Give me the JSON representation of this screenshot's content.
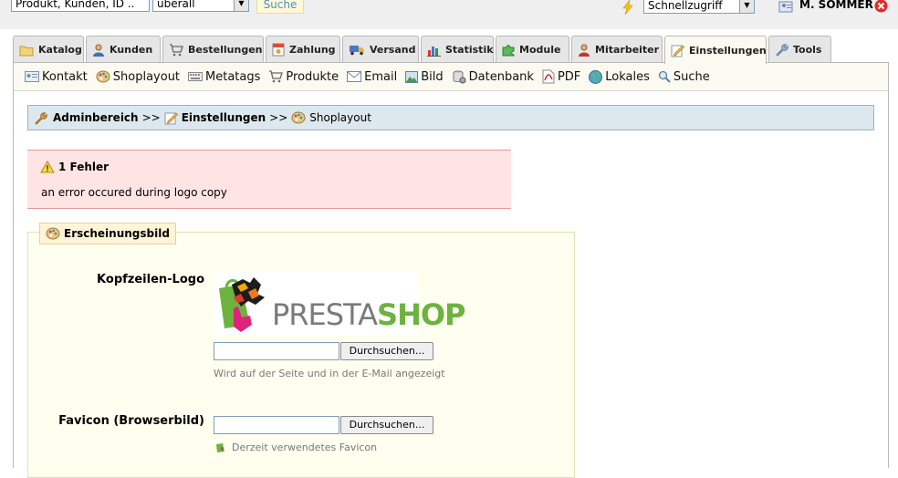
{
  "topbar": {
    "search_value": "Produkt, Kunden, ID ..",
    "scope_value": "überall",
    "search_button": "Suche",
    "quick_access": "Schnellzugriff",
    "user_name": "M. SOMMER"
  },
  "tabs": [
    {
      "label": "Katalog",
      "icon": "folder-icon"
    },
    {
      "label": "Kunden",
      "icon": "user-icon"
    },
    {
      "label": "Bestellungen",
      "icon": "cart-icon"
    },
    {
      "label": "Zahlung",
      "icon": "payment-icon"
    },
    {
      "label": "Versand",
      "icon": "truck-icon"
    },
    {
      "label": "Statistik",
      "icon": "chart-icon"
    },
    {
      "label": "Module",
      "icon": "puzzle-icon"
    },
    {
      "label": "Mitarbeiter",
      "icon": "staff-icon"
    },
    {
      "label": "Einstellungen",
      "icon": "settings-icon",
      "active": true
    },
    {
      "label": "Tools",
      "icon": "wrench-icon"
    }
  ],
  "subnav": [
    {
      "label": "Kontakt",
      "icon": "contact-card-icon"
    },
    {
      "label": "Shoplayout",
      "icon": "palette-icon"
    },
    {
      "label": "Metatags",
      "icon": "keyboard-icon"
    },
    {
      "label": "Produkte",
      "icon": "cart-icon"
    },
    {
      "label": "Email",
      "icon": "email-icon"
    },
    {
      "label": "Bild",
      "icon": "image-icon"
    },
    {
      "label": "Datenbank",
      "icon": "database-icon"
    },
    {
      "label": "PDF",
      "icon": "pdf-icon"
    },
    {
      "label": "Lokales",
      "icon": "globe-icon"
    },
    {
      "label": "Suche",
      "icon": "magnifier-icon"
    }
  ],
  "breadcrumb": {
    "root": "Adminbereich",
    "separator": ">>",
    "section": "Einstellungen",
    "current": "Shoplayout"
  },
  "error": {
    "title": "1 Fehler",
    "message": "an error occured during logo copy"
  },
  "appearance": {
    "legend": "Erscheinungsbild",
    "header_logo_label": "Kopfzeilen-Logo",
    "logo_text_presta": "PRESTA",
    "logo_text_shop": "SHOP",
    "browse_label": "Durchsuchen...",
    "logo_hint": "Wird auf der Seite und in der E-Mail angezeigt",
    "favicon_label": "Favicon (Browserbild)",
    "favicon_hint": "Derzeit verwendetes Favicon"
  },
  "colors": {
    "breadcrumb_bg": "#dde7ee",
    "error_bg": "#ffe4e4",
    "fieldset_bg": "#fffff0",
    "presta_gray": "#7a7a7a",
    "shop_green": "#6cb33f"
  }
}
